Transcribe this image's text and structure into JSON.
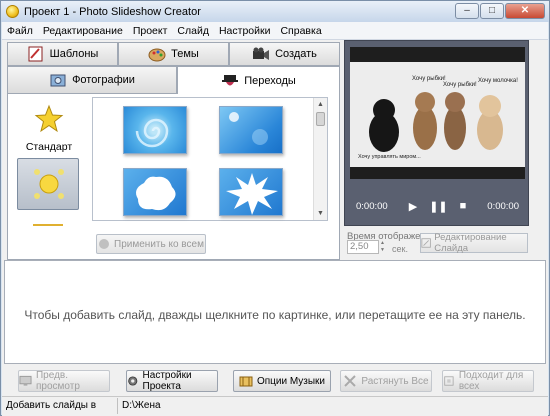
{
  "window": {
    "title": "Проект 1 - Photo Slideshow Creator",
    "min": "–",
    "max": "□",
    "close": "✕"
  },
  "menu": [
    "Файл",
    "Редактирование",
    "Проект",
    "Слайд",
    "Настройки",
    "Справка"
  ],
  "tabs_top": [
    {
      "label": "Шаблоны",
      "icon": "templates-icon"
    },
    {
      "label": "Темы",
      "icon": "themes-icon"
    },
    {
      "label": "Создать",
      "icon": "camera-icon"
    }
  ],
  "tabs_second": [
    {
      "label": "Фотографии",
      "icon": "photos-icon",
      "active": false
    },
    {
      "label": "Переходы",
      "icon": "transitions-icon",
      "active": true
    }
  ],
  "categories": [
    {
      "label": "Стандарт",
      "icon": "star-icon"
    },
    {
      "label": "",
      "icon": "sun-icon",
      "selected": true
    }
  ],
  "apply_all_button": "Применить ко всем",
  "preview": {
    "captions": [
      "Хочу рыбки!",
      "Хочу рыбки!",
      "Хочу молочка!",
      "Хочу управлять миром..."
    ],
    "time_start": "0:00:00",
    "time_end": "0:00:00"
  },
  "duration": {
    "label": "Время отображения",
    "value": "2,50",
    "unit": "сек."
  },
  "edit_slide_button": "Редактирование Слайда",
  "drop_hint": "Чтобы добавить слайд, дважды щелкните по картинке, или перетащите ее на эту панель.",
  "bottom_buttons": {
    "preview": "Предв. просмотр",
    "project_settings": "Настройки Проекта",
    "music_options": "Опции Музыки",
    "stretch_all": "Растянуть Все",
    "fit_all": "Подходит для всех"
  },
  "status": {
    "message": "Добавить слайды в проект ...",
    "path": "D:\\Жена"
  }
}
